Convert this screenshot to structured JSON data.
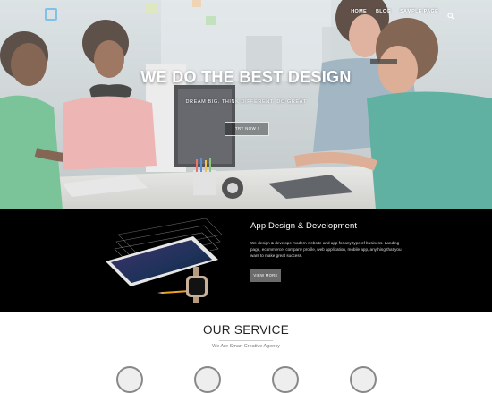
{
  "header": {
    "nav": [
      {
        "label": "HOME"
      },
      {
        "label": "BLOG"
      },
      {
        "label": "SAMPLE PAGE"
      }
    ],
    "search_icon": "search-icon"
  },
  "hero": {
    "title": "WE DO THE BEST DESIGN",
    "subtitle": "DREAM BIG. THINK DIFFERENT. DO GREAT",
    "button_label": "TRY NOW !"
  },
  "app_section": {
    "title": "App Design & Development",
    "description": "We design & develope modern website and app for any type of business. Landing page, ecommerce, company profile, web application, mobile app, anything that you want to make great success.",
    "button_label": "VIEW MORE"
  },
  "service": {
    "title": "OUR SERVICE",
    "subtitle": "We Are Smart Creative Agency"
  },
  "colors": {
    "app_bg": "#000000",
    "button_gray": "#6b6b6b"
  }
}
